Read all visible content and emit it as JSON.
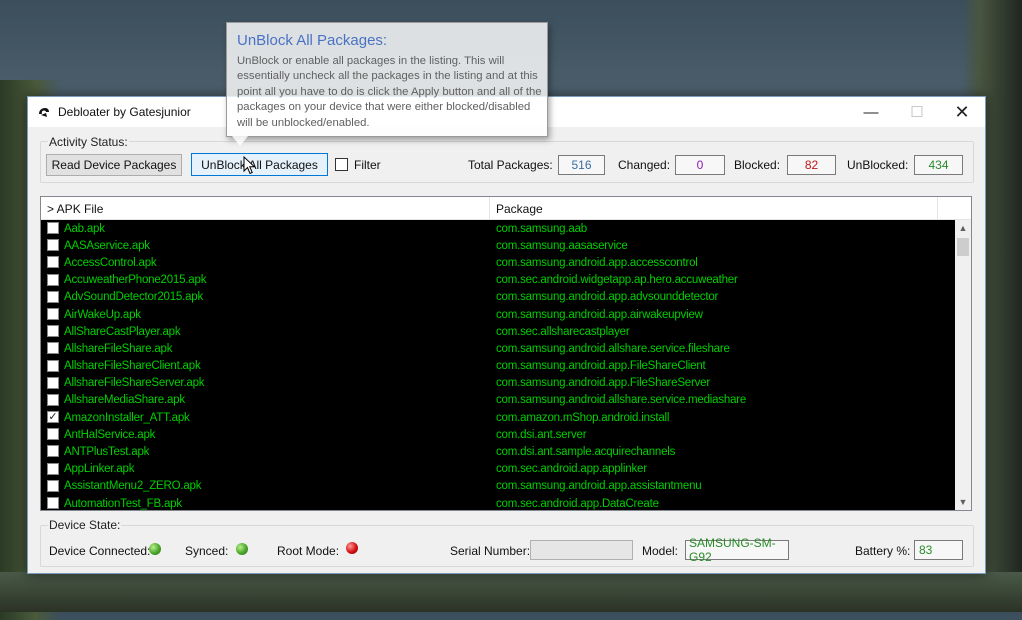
{
  "window": {
    "title": "Debloater by Gatesjunior",
    "controls": {
      "minimize": "—",
      "maximize": "☐",
      "close": "✕"
    }
  },
  "activity": {
    "label": "Activity Status:",
    "read_button": "Read Device Packages",
    "unblock_button": "UnBlock All Packages",
    "filter_label": "Filter",
    "total_label": "Total Packages:",
    "total_value": "516",
    "changed_label": "Changed:",
    "changed_value": "0",
    "blocked_label": "Blocked:",
    "blocked_value": "82",
    "unblocked_label": "UnBlocked:",
    "unblocked_value": "434",
    "colors": {
      "total": "#3a6ea5",
      "changed": "#8a1ab8",
      "blocked": "#c01818",
      "unblocked": "#2a8a2a"
    }
  },
  "list": {
    "columns": [
      "> APK File",
      "Package"
    ],
    "rows": [
      {
        "apk": "Aab.apk",
        "pkg": "com.samsung.aab",
        "checked": false
      },
      {
        "apk": "AASAservice.apk",
        "pkg": "com.samsung.aasaservice",
        "checked": false
      },
      {
        "apk": "AccessControl.apk",
        "pkg": "com.samsung.android.app.accesscontrol",
        "checked": false
      },
      {
        "apk": "AccuweatherPhone2015.apk",
        "pkg": "com.sec.android.widgetapp.ap.hero.accuweather",
        "checked": false
      },
      {
        "apk": "AdvSoundDetector2015.apk",
        "pkg": "com.samsung.android.app.advsounddetector",
        "checked": false
      },
      {
        "apk": "AirWakeUp.apk",
        "pkg": "com.samsung.android.app.airwakeupview",
        "checked": false
      },
      {
        "apk": "AllShareCastPlayer.apk",
        "pkg": "com.sec.allsharecastplayer",
        "checked": false
      },
      {
        "apk": "AllshareFileShare.apk",
        "pkg": "com.samsung.android.allshare.service.fileshare",
        "checked": false
      },
      {
        "apk": "AllshareFileShareClient.apk",
        "pkg": "com.samsung.android.app.FileShareClient",
        "checked": false
      },
      {
        "apk": "AllshareFileShareServer.apk",
        "pkg": "com.samsung.android.app.FileShareServer",
        "checked": false
      },
      {
        "apk": "AllshareMediaShare.apk",
        "pkg": "com.samsung.android.allshare.service.mediashare",
        "checked": false
      },
      {
        "apk": "AmazonInstaller_ATT.apk",
        "pkg": "com.amazon.mShop.android.install",
        "checked": true
      },
      {
        "apk": "AntHalService.apk",
        "pkg": "com.dsi.ant.server",
        "checked": false
      },
      {
        "apk": "ANTPlusTest.apk",
        "pkg": "com.dsi.ant.sample.acquirechannels",
        "checked": false
      },
      {
        "apk": "AppLinker.apk",
        "pkg": "com.sec.android.app.applinker",
        "checked": false
      },
      {
        "apk": "AssistantMenu2_ZERO.apk",
        "pkg": "com.samsung.android.app.assistantmenu",
        "checked": false
      },
      {
        "apk": "AutomationTest_FB.apk",
        "pkg": "com.sec.android.app.DataCreate",
        "checked": false
      }
    ]
  },
  "device": {
    "label": "Device State:",
    "connected_label": "Device Connected:",
    "synced_label": "Synced:",
    "root_label": "Root Mode:",
    "serial_label": "Serial Number:",
    "serial_value": "",
    "model_label": "Model:",
    "model_value": "SAMSUNG-SM-G92",
    "battery_label": "Battery %:",
    "battery_value": "83",
    "status": {
      "connected": "green",
      "synced": "green",
      "root": "red"
    }
  },
  "tooltip": {
    "title": "UnBlock All Packages:",
    "body": "UnBlock or enable all packages in the listing.  This will essentially uncheck all the packages in the listing and at this point all you have to do is click the Apply button and all of the packages on your device that were either blocked/disabled will be unblocked/enabled."
  }
}
